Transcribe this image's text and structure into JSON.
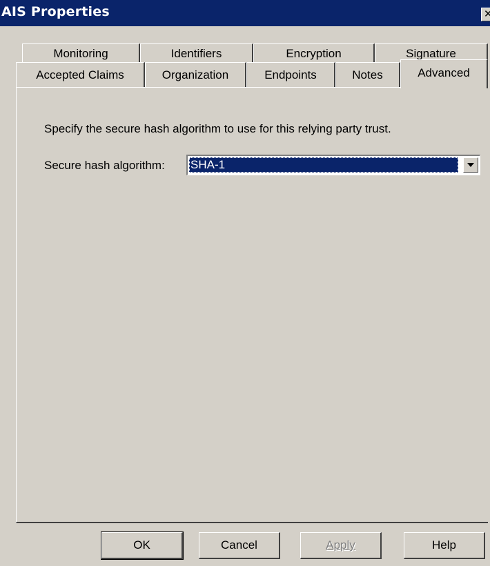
{
  "window": {
    "title": "AIS Properties",
    "close_glyph": "✕"
  },
  "tabs": {
    "row1": [
      "Monitoring",
      "Identifiers",
      "Encryption",
      "Signature"
    ],
    "row2": [
      "Accepted Claims",
      "Organization",
      "Endpoints",
      "Notes",
      "Advanced"
    ],
    "active": "Advanced"
  },
  "advanced": {
    "description": "Specify the secure hash algorithm to use for this relying party trust.",
    "hash_label": "Secure hash algorithm:",
    "hash_value": "SHA-1"
  },
  "buttons": {
    "ok": "OK",
    "cancel": "Cancel",
    "apply": "Apply",
    "help": "Help"
  },
  "colors": {
    "titlebar": "#0a246a",
    "face": "#d4d0c8",
    "selection": "#0a246a"
  }
}
